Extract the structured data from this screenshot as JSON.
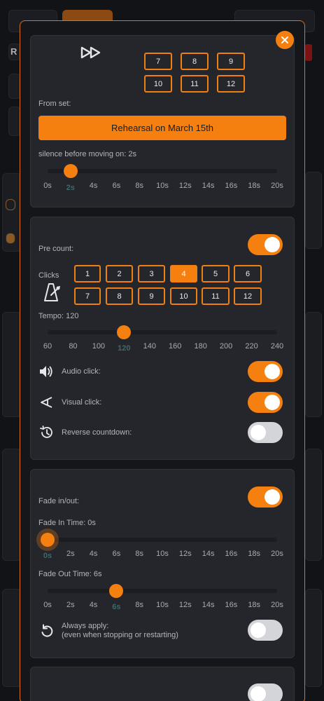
{
  "colors": {
    "accent": "#f5800f",
    "modal_bg": "#15161a",
    "card_bg": "#25262c",
    "text": "#b3b5bc"
  },
  "close_icon": "close-icon",
  "auto_advance": {
    "icon": "fast-forward-icon",
    "set_numbers": [
      "7",
      "8",
      "9",
      "10",
      "11",
      "12"
    ],
    "from_set_label": "From set:",
    "set_button_label": "Rehearsal on March 15th",
    "silence_label": "silence before moving on: 2s",
    "silence_value": 2,
    "silence_ticks": [
      "0s",
      "2s",
      "4s",
      "6s",
      "8s",
      "10s",
      "12s",
      "14s",
      "16s",
      "18s",
      "20s"
    ]
  },
  "precount": {
    "label": "Pre count:",
    "enabled": true,
    "clicks_label": "Clicks",
    "clicks": [
      "1",
      "2",
      "3",
      "4",
      "5",
      "6",
      "7",
      "8",
      "9",
      "10",
      "11",
      "12"
    ],
    "selected_click": "4",
    "tempo_label": "Tempo: 120",
    "tempo_value": 120,
    "tempo_ticks": [
      "60",
      "80",
      "100",
      "120",
      "140",
      "160",
      "180",
      "200",
      "220",
      "240"
    ],
    "audio_click_label": "Audio click:",
    "audio_click_on": true,
    "visual_click_label": "Visual click:",
    "visual_click_on": true,
    "reverse_countdown_label": "Reverse countdown:",
    "reverse_countdown_on": false
  },
  "fade": {
    "label": "Fade in/out:",
    "enabled": true,
    "fade_in_label": "Fade In Time: 0s",
    "fade_in_value": 0,
    "fade_out_label": "Fade Out Time: 6s",
    "fade_out_value": 6,
    "ticks": [
      "0s",
      "2s",
      "4s",
      "6s",
      "8s",
      "10s",
      "12s",
      "14s",
      "16s",
      "18s",
      "20s"
    ],
    "always_apply_label": "Always apply:",
    "always_apply_sub": "(even when stopping or restarting)",
    "always_apply_on": false
  },
  "background": {
    "letter_r": "R"
  }
}
